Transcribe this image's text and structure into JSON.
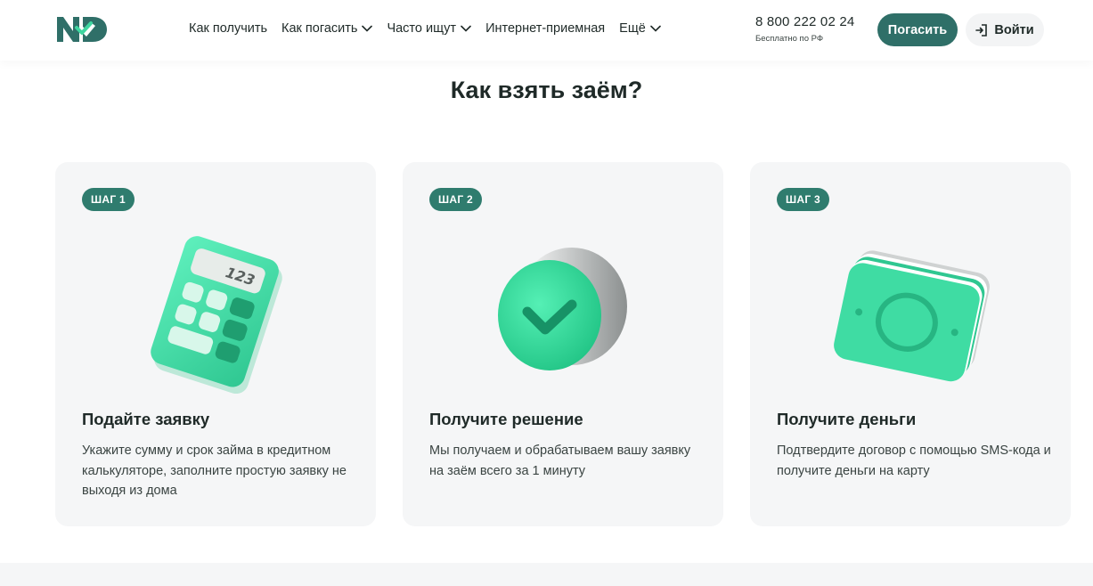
{
  "header": {
    "logo_text": "ND",
    "nav": [
      {
        "label": "Как получить",
        "has_dropdown": false
      },
      {
        "label": "Как погасить",
        "has_dropdown": true
      },
      {
        "label": "Часто ищут",
        "has_dropdown": true
      },
      {
        "label": "Интернет-приемная",
        "has_dropdown": false
      },
      {
        "label": "Ещё",
        "has_dropdown": true
      }
    ],
    "phone": "8 800 222 02 24",
    "phone_note": "Бесплатно по РФ",
    "pay_button": "Погасить",
    "login_button": "Войти"
  },
  "section": {
    "title": "Как взять заём?",
    "steps": [
      {
        "badge": "ШАГ 1",
        "title": "Подайте заявку",
        "text": "Укажите сумму и срок займа в кредитном калькуляторе, заполните простую заявку не выходя из дома",
        "icon": "calculator-icon"
      },
      {
        "badge": "ШАГ 2",
        "title": "Получите решение",
        "text": "Мы получаем и обрабатываем вашу заявку на заём всего за 1 минуту",
        "icon": "checkmark-coin-icon"
      },
      {
        "badge": "ШАГ 3",
        "title": "Получите деньги",
        "text": "Подтвердите договор с помощью SMS-кода и получите деньги на карту",
        "icon": "banknotes-icon"
      }
    ],
    "calculator_display": "123"
  },
  "colors": {
    "brand": "#2f6f68",
    "badge": "#2f7c6e",
    "accent_green": "#3ed6a0",
    "card_bg": "#f5f6f7"
  }
}
